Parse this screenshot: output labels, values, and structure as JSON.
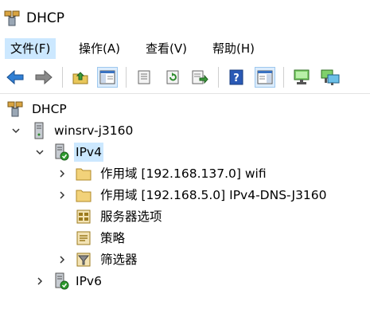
{
  "window": {
    "title": "DHCP"
  },
  "menu": [
    {
      "label": "文件(F)",
      "active": true
    },
    {
      "label": "操作(A)",
      "active": false
    },
    {
      "label": "查看(V)",
      "active": false
    },
    {
      "label": "帮助(H)",
      "active": false
    }
  ],
  "toolbar": {
    "buttons": [
      "back-icon",
      "forward-icon",
      "up-folder-icon",
      "show-hide-tree-icon",
      "properties-icon",
      "refresh-icon",
      "export-list-icon",
      "help-icon",
      "show-hide-action-pane-icon",
      "server-authorize-icon",
      "server-unauthorize-icon"
    ]
  },
  "tree": {
    "root": "DHCP",
    "server": "winsrv-j3160",
    "ipv4": "IPv4",
    "scope1": "作用域 [192.168.137.0] wifi",
    "scope2": "作用域 [192.168.5.0] IPv4-DNS-J3160",
    "server_options": "服务器选项",
    "policies": "策略",
    "filters": "筛选器",
    "ipv6": "IPv6"
  },
  "colors": {
    "selection": "#cce8ff",
    "accent": "#2f6fc6"
  }
}
